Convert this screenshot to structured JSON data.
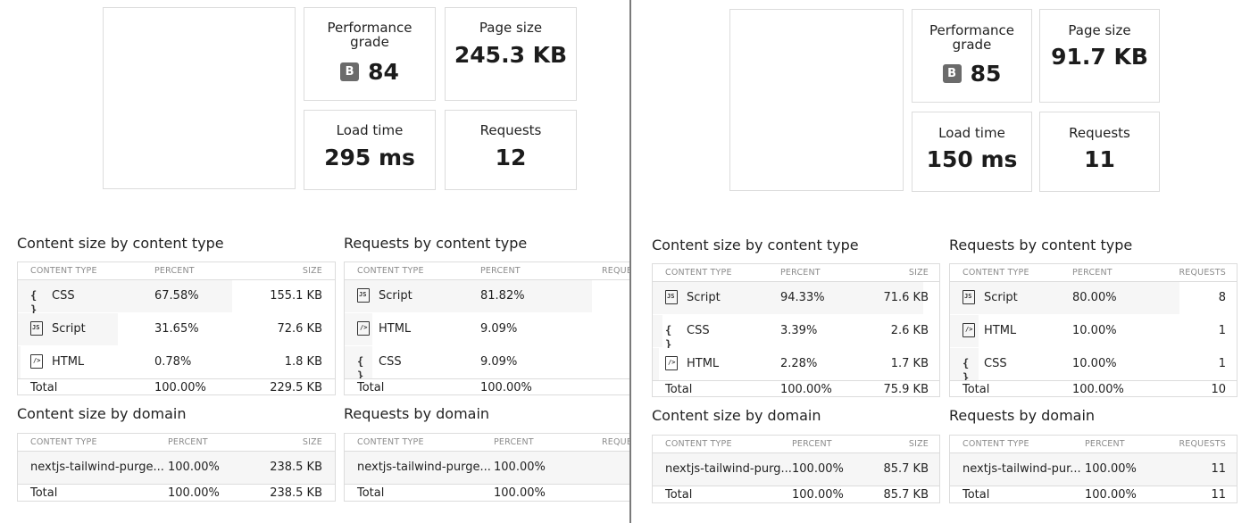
{
  "left": {
    "stats": {
      "performance_label": "Performance grade",
      "grade": "B",
      "grade_value": "84",
      "page_size_label": "Page size",
      "page_size": "245.3 KB",
      "load_time_label": "Load time",
      "load_time": "295 ms",
      "requests_label": "Requests",
      "requests": "12"
    },
    "size_type": {
      "title": "Content size by content type",
      "headers": [
        "CONTENT TYPE",
        "PERCENT",
        "SIZE"
      ],
      "rows": [
        {
          "icon": "css-braces-icon",
          "type": "CSS",
          "percent": "67.58%",
          "value": "155.1 KB",
          "fill": 0.6758
        },
        {
          "icon": "script-file-icon",
          "type": "Script",
          "percent": "31.65%",
          "value": "72.6 KB",
          "fill": 0.3165
        },
        {
          "icon": "html-file-icon",
          "type": "HTML",
          "percent": "0.78%",
          "value": "1.8 KB",
          "fill": 0.0078
        }
      ],
      "total": {
        "label": "Total",
        "percent": "100.00%",
        "value": "229.5 KB"
      }
    },
    "req_type": {
      "title": "Requests by content type",
      "headers": [
        "CONTENT TYPE",
        "PERCENT",
        "REQUE"
      ],
      "rows": [
        {
          "icon": "script-file-icon",
          "type": "Script",
          "percent": "81.82%",
          "value": "",
          "fill": 0.8182
        },
        {
          "icon": "html-file-icon",
          "type": "HTML",
          "percent": "9.09%",
          "value": "",
          "fill": 0.0909
        },
        {
          "icon": "css-braces-icon",
          "type": "CSS",
          "percent": "9.09%",
          "value": "",
          "fill": 0.0909
        }
      ],
      "total": {
        "label": "Total",
        "percent": "100.00%",
        "value": ""
      }
    },
    "size_domain": {
      "title": "Content size by domain",
      "headers": [
        "CONTENT TYPE",
        "PERCENT",
        "SIZE"
      ],
      "row": {
        "domain": "nextjs-tailwind-purge...",
        "percent": "100.00%",
        "value": "238.5 KB"
      },
      "total": {
        "label": "Total",
        "percent": "100.00%",
        "value": "238.5 KB"
      }
    },
    "req_domain": {
      "title": "Requests by domain",
      "headers": [
        "CONTENT TYPE",
        "PERCENT",
        "REQUE"
      ],
      "row": {
        "domain": "nextjs-tailwind-purge...",
        "percent": "100.00%",
        "value": ""
      },
      "total": {
        "label": "Total",
        "percent": "100.00%",
        "value": ""
      }
    }
  },
  "right": {
    "stats": {
      "performance_label": "Performance grade",
      "grade": "B",
      "grade_value": "85",
      "page_size_label": "Page size",
      "page_size": "91.7 KB",
      "load_time_label": "Load time",
      "load_time": "150 ms",
      "requests_label": "Requests",
      "requests": "11"
    },
    "size_type": {
      "title": "Content size by content type",
      "headers": [
        "CONTENT TYPE",
        "PERCENT",
        "SIZE"
      ],
      "rows": [
        {
          "icon": "script-file-icon",
          "type": "Script",
          "percent": "94.33%",
          "value": "71.6 KB",
          "fill": 0.9433
        },
        {
          "icon": "css-braces-icon",
          "type": "CSS",
          "percent": "3.39%",
          "value": "2.6 KB",
          "fill": 0.0339
        },
        {
          "icon": "html-file-icon",
          "type": "HTML",
          "percent": "2.28%",
          "value": "1.7 KB",
          "fill": 0.0228
        }
      ],
      "total": {
        "label": "Total",
        "percent": "100.00%",
        "value": "75.9 KB"
      }
    },
    "req_type": {
      "title": "Requests by content type",
      "headers": [
        "CONTENT TYPE",
        "PERCENT",
        "REQUESTS"
      ],
      "rows": [
        {
          "icon": "script-file-icon",
          "type": "Script",
          "percent": "80.00%",
          "value": "8",
          "fill": 0.8
        },
        {
          "icon": "html-file-icon",
          "type": "HTML",
          "percent": "10.00%",
          "value": "1",
          "fill": 0.1
        },
        {
          "icon": "css-braces-icon",
          "type": "CSS",
          "percent": "10.00%",
          "value": "1",
          "fill": 0.1
        }
      ],
      "total": {
        "label": "Total",
        "percent": "100.00%",
        "value": "10"
      }
    },
    "size_domain": {
      "title": "Content size by domain",
      "headers": [
        "CONTENT TYPE",
        "PERCENT",
        "SIZE"
      ],
      "row": {
        "domain": "nextjs-tailwind-purg...",
        "percent": "100.00%",
        "value": "85.7 KB"
      },
      "total": {
        "label": "Total",
        "percent": "100.00%",
        "value": "85.7 KB"
      }
    },
    "req_domain": {
      "title": "Requests by domain",
      "headers": [
        "CONTENT TYPE",
        "PERCENT",
        "REQUESTS"
      ],
      "row": {
        "domain": "nextjs-tailwind-pur...",
        "percent": "100.00%",
        "value": "11"
      },
      "total": {
        "label": "Total",
        "percent": "100.00%",
        "value": "11"
      }
    }
  }
}
